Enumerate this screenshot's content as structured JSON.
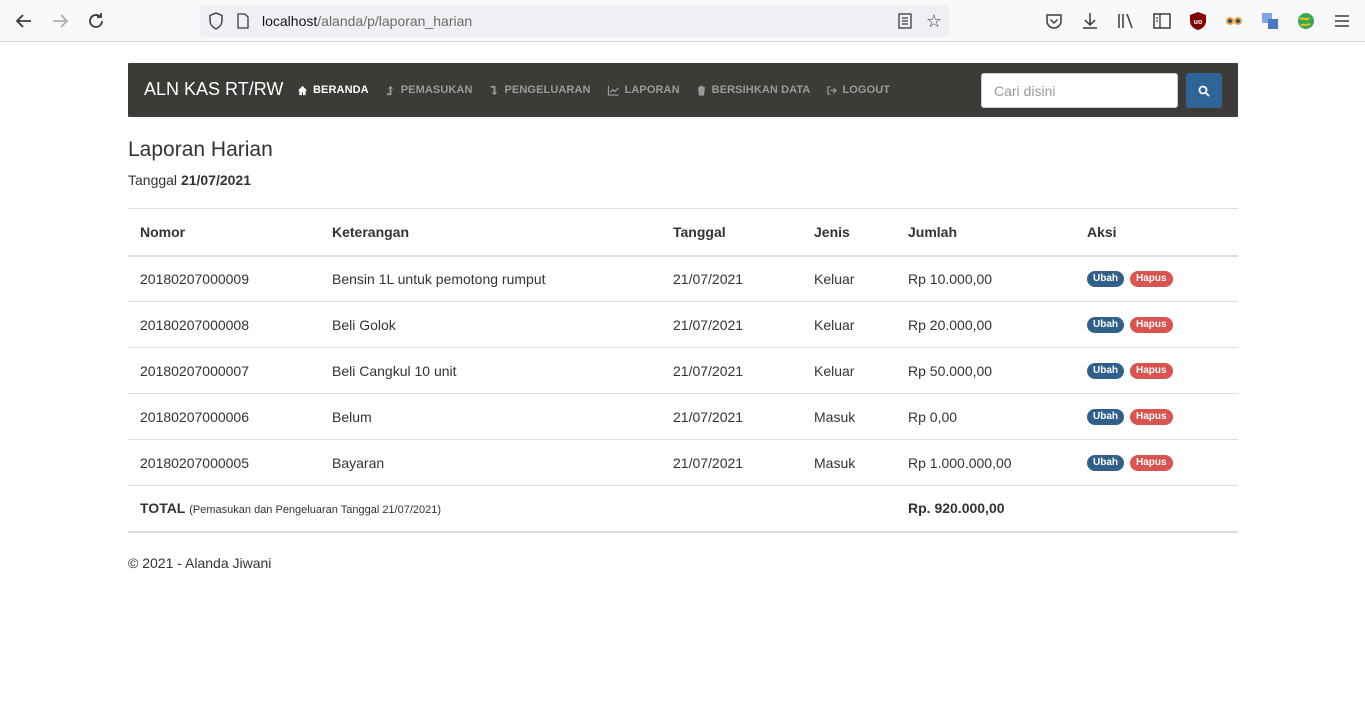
{
  "browser": {
    "url_host": "localhost",
    "url_path": "/alanda/p/laporan_harian"
  },
  "navbar": {
    "brand": "ALN KAS RT/RW",
    "items": [
      {
        "label": "BERANDA",
        "icon": "home-icon",
        "active": true
      },
      {
        "label": "PEMASUKAN",
        "icon": "arrow-up-icon",
        "active": false
      },
      {
        "label": "PENGELUARAN",
        "icon": "arrow-down-icon",
        "active": false
      },
      {
        "label": "LAPORAN",
        "icon": "chart-icon",
        "active": false
      },
      {
        "label": "BERSIHKAN DATA",
        "icon": "trash-icon",
        "active": false
      },
      {
        "label": "LOGOUT",
        "icon": "logout-icon",
        "active": false
      }
    ],
    "search_placeholder": "Cari disini"
  },
  "page": {
    "title": "Laporan Harian",
    "date_label": "Tanggal",
    "date_value": "21/07/2021"
  },
  "table": {
    "headers": [
      "Nomor",
      "Keterangan",
      "Tanggal",
      "Jenis",
      "Jumlah",
      "Aksi"
    ],
    "rows": [
      {
        "nomor": "20180207000009",
        "keterangan": "Bensin 1L untuk pemotong rumput",
        "tanggal": "21/07/2021",
        "jenis": "Keluar",
        "jumlah": "Rp 10.000,00"
      },
      {
        "nomor": "20180207000008",
        "keterangan": "Beli Golok",
        "tanggal": "21/07/2021",
        "jenis": "Keluar",
        "jumlah": "Rp 20.000,00"
      },
      {
        "nomor": "20180207000007",
        "keterangan": "Beli Cangkul 10 unit",
        "tanggal": "21/07/2021",
        "jenis": "Keluar",
        "jumlah": "Rp 50.000,00"
      },
      {
        "nomor": "20180207000006",
        "keterangan": "Belum",
        "tanggal": "21/07/2021",
        "jenis": "Masuk",
        "jumlah": "Rp 0,00"
      },
      {
        "nomor": "20180207000005",
        "keterangan": "Bayaran",
        "tanggal": "21/07/2021",
        "jenis": "Masuk",
        "jumlah": "Rp 1.000.000,00"
      }
    ],
    "edit_label": "Ubah",
    "delete_label": "Hapus",
    "total_label": "TOTAL",
    "total_note": "(Pemasukan dan Pengeluaran Tanggal 21/07/2021)",
    "total_value": "Rp. 920.000,00"
  },
  "footer": {
    "text": "© 2021 - Alanda Jiwani"
  },
  "colors": {
    "navbar_bg": "#3c3b38",
    "primary": "#2f6497",
    "edit_badge": "#2f5f8a",
    "delete_badge": "#d9534f"
  }
}
